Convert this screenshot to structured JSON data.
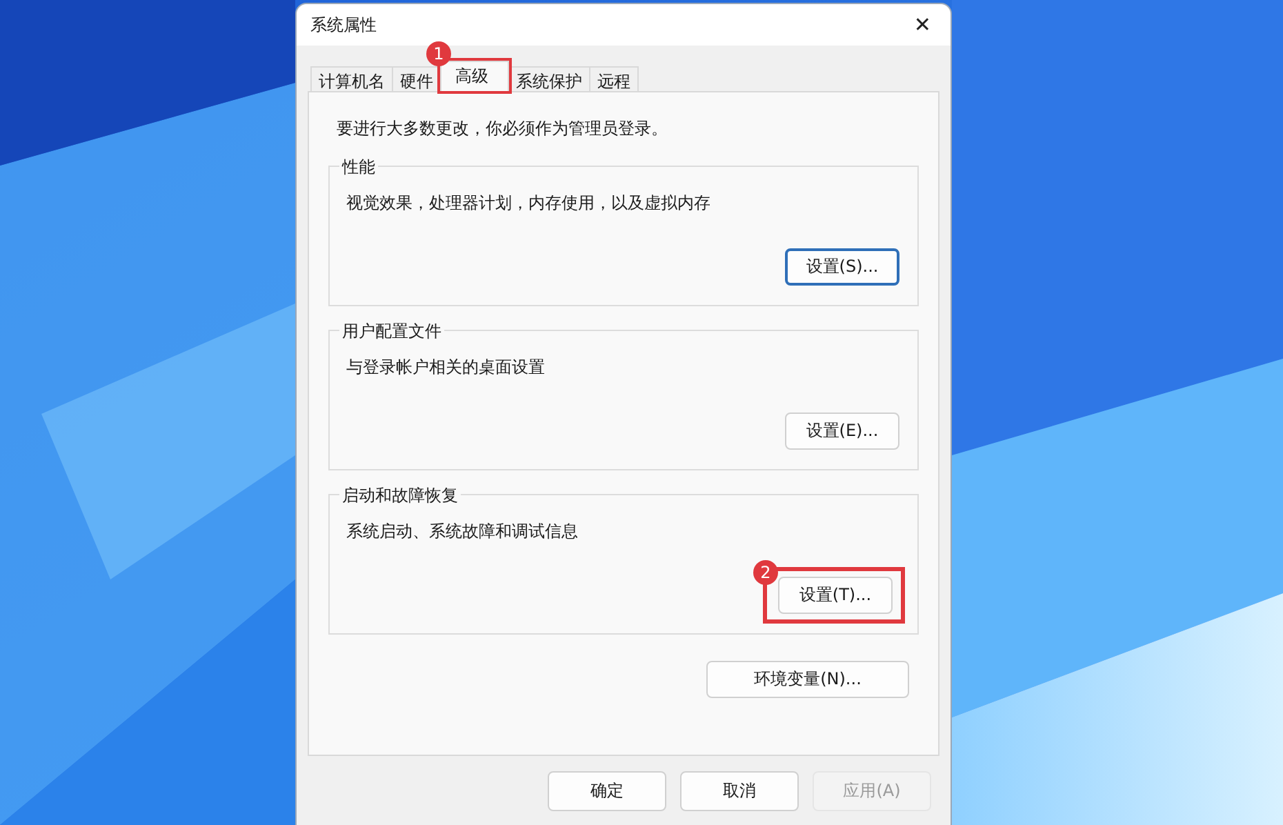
{
  "window": {
    "title": "系统属性",
    "close": "✕"
  },
  "tabs": [
    {
      "label": "计算机名",
      "selected": false
    },
    {
      "label": "硬件",
      "selected": false
    },
    {
      "label": "高级",
      "selected": true,
      "callout": "1"
    },
    {
      "label": "系统保护",
      "selected": false
    },
    {
      "label": "远程",
      "selected": false
    }
  ],
  "notice": "要进行大多数更改，你必须作为管理员登录。",
  "groups": [
    {
      "title": "性能",
      "description": "视觉效果，处理器计划，内存使用，以及虚拟内存",
      "button": {
        "label": "设置(S)...",
        "default": true
      }
    },
    {
      "title": "用户配置文件",
      "description": "与登录帐户相关的桌面设置",
      "button": {
        "label": "设置(E)...",
        "default": false
      }
    },
    {
      "title": "启动和故障恢复",
      "description": "系统启动、系统故障和调试信息",
      "button": {
        "label": "设置(T)...",
        "default": false,
        "callout": "2"
      }
    }
  ],
  "env_button": {
    "label": "环境变量(N)..."
  },
  "buttons": [
    {
      "label": "确定",
      "disabled": false
    },
    {
      "label": "取消",
      "disabled": false
    },
    {
      "label": "应用(A)",
      "disabled": true
    }
  ]
}
